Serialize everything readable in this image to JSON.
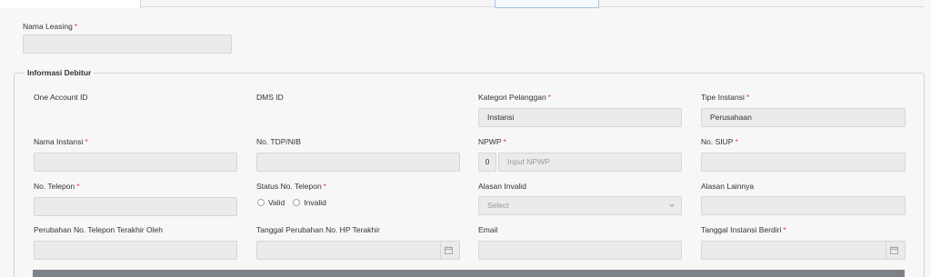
{
  "top": {
    "nama_leasing": {
      "label": "Nama Leasing",
      "value": ""
    }
  },
  "informasi_debitur": {
    "legend": "Informasi Debitur",
    "one_account_id": {
      "label": "One Account ID",
      "value": ""
    },
    "dms_id": {
      "label": "DMS ID",
      "value": ""
    },
    "kategori_pelanggan": {
      "label": "Kategori Pelanggan",
      "value": "Instansi"
    },
    "tipe_instansi": {
      "label": "Tipe Instansi",
      "value": "Perusahaan"
    },
    "nama_instansi": {
      "label": "Nama Instansi",
      "value": ""
    },
    "no_tdp_nib": {
      "label": "No. TDP/NIB",
      "value": ""
    },
    "npwp": {
      "label": "NPWP",
      "prefix": "0",
      "placeholder": "Input NPWP"
    },
    "no_siup": {
      "label": "No. SIUP",
      "value": ""
    },
    "no_telepon": {
      "label": "No. Telepon",
      "value": ""
    },
    "status_no_telepon": {
      "label": "Status No. Telepon",
      "options": [
        "Valid",
        "Invalid"
      ]
    },
    "alasan_invalid": {
      "label": "Alasan Invalid",
      "placeholder": "Select"
    },
    "alasan_lainnya": {
      "label": "Alasan Lainnya",
      "value": ""
    },
    "perubahan_oleh": {
      "label": "Perubahan No. Telepon Terakhir Oleh",
      "value": ""
    },
    "tanggal_perubahan": {
      "label": "Tanggal Perubahan No. HP Terakhir",
      "value": ""
    },
    "email": {
      "label": "Email",
      "value": ""
    },
    "tanggal_instansi_berdiri": {
      "label": "Tanggal Instansi Berdiri",
      "value": ""
    }
  },
  "required_marker": "*",
  "icons": {
    "calendar": "calendar-icon",
    "dropdown": "chevron-down-icon"
  }
}
